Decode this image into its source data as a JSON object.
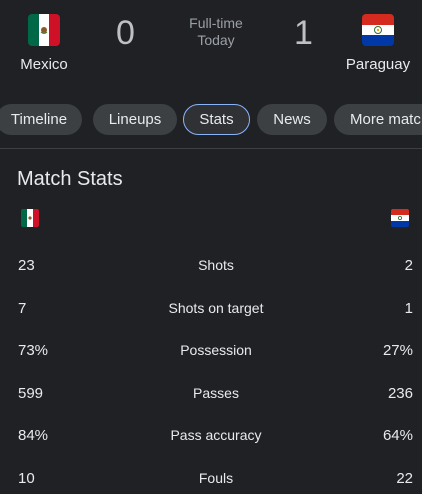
{
  "match": {
    "home_team": {
      "name": "Mexico",
      "score": "0",
      "flag": "mexico-flag"
    },
    "away_team": {
      "name": "Paraguay",
      "score": "1",
      "flag": "paraguay-flag"
    },
    "status_line1": "Full-time",
    "status_line2": "Today"
  },
  "tabs": [
    {
      "label": "Timeline"
    },
    {
      "label": "Lineups"
    },
    {
      "label": "Stats",
      "active": true
    },
    {
      "label": "News"
    },
    {
      "label": "More matc"
    }
  ],
  "section": {
    "title": "Match Stats"
  },
  "stats": [
    {
      "home": "23",
      "name": "Shots",
      "away": "2"
    },
    {
      "home": "7",
      "name": "Shots on target",
      "away": "1"
    },
    {
      "home": "73%",
      "name": "Possession",
      "away": "27%"
    },
    {
      "home": "599",
      "name": "Passes",
      "away": "236"
    },
    {
      "home": "84%",
      "name": "Pass accuracy",
      "away": "64%"
    },
    {
      "home": "10",
      "name": "Fouls",
      "away": "22"
    }
  ],
  "colors": {
    "background": "#202124",
    "active_tab_border": "#8ab4f8"
  }
}
